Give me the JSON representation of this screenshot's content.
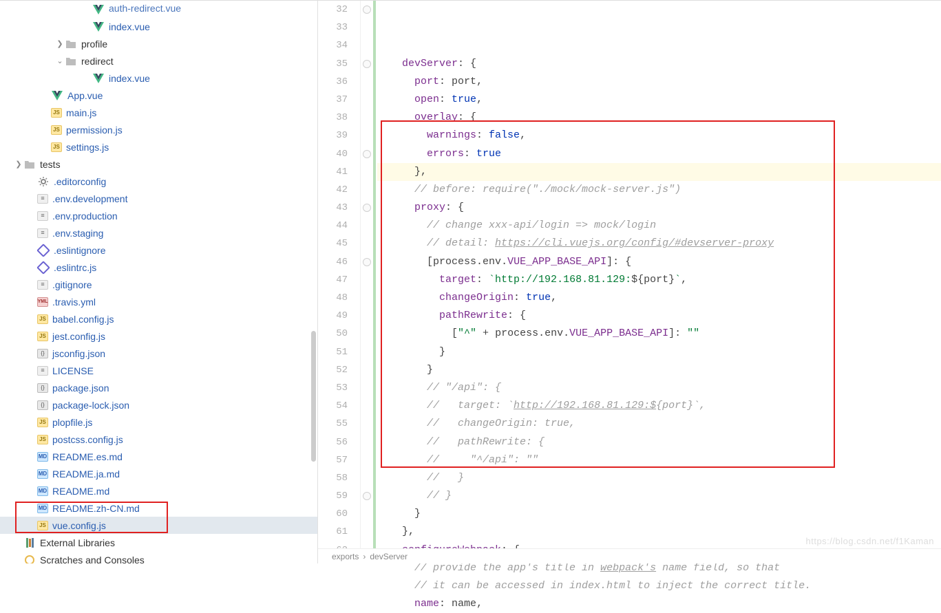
{
  "tree": {
    "items": [
      {
        "depth": 5,
        "chev": "",
        "iconType": "vue",
        "label": "auth-redirect.vue",
        "dark": false,
        "cut": true
      },
      {
        "depth": 5,
        "chev": "",
        "iconType": "vue",
        "label": "index.vue",
        "dark": false
      },
      {
        "depth": 3,
        "chev": ">",
        "iconType": "folder",
        "label": "profile",
        "dark": true
      },
      {
        "depth": 3,
        "chev": "v",
        "iconType": "folder",
        "label": "redirect",
        "dark": true
      },
      {
        "depth": 5,
        "chev": "",
        "iconType": "vue",
        "label": "index.vue",
        "dark": false
      },
      {
        "depth": 2,
        "chev": "",
        "iconType": "vue",
        "label": "App.vue",
        "dark": false
      },
      {
        "depth": 2,
        "chev": "",
        "iconType": "js",
        "label": "main.js",
        "dark": false
      },
      {
        "depth": 2,
        "chev": "",
        "iconType": "js",
        "label": "permission.js",
        "dark": false
      },
      {
        "depth": 2,
        "chev": "",
        "iconType": "js",
        "label": "settings.js",
        "dark": false
      },
      {
        "depth": 0,
        "chev": ">",
        "iconType": "folder",
        "label": "tests",
        "dark": true
      },
      {
        "depth": 1,
        "chev": "",
        "iconType": "gear",
        "label": ".editorconfig",
        "dark": false
      },
      {
        "depth": 1,
        "chev": "",
        "iconType": "txt",
        "label": ".env.development",
        "dark": false
      },
      {
        "depth": 1,
        "chev": "",
        "iconType": "txt",
        "label": ".env.production",
        "dark": false
      },
      {
        "depth": 1,
        "chev": "",
        "iconType": "txt",
        "label": ".env.staging",
        "dark": false
      },
      {
        "depth": 1,
        "chev": "",
        "iconType": "eslint",
        "label": ".eslintignore",
        "dark": false
      },
      {
        "depth": 1,
        "chev": "",
        "iconType": "eslint",
        "label": ".eslintrc.js",
        "dark": false
      },
      {
        "depth": 1,
        "chev": "",
        "iconType": "txt",
        "label": ".gitignore",
        "dark": false
      },
      {
        "depth": 1,
        "chev": "",
        "iconType": "yml",
        "label": ".travis.yml",
        "dark": false
      },
      {
        "depth": 1,
        "chev": "",
        "iconType": "js",
        "label": "babel.config.js",
        "dark": false
      },
      {
        "depth": 1,
        "chev": "",
        "iconType": "js",
        "label": "jest.config.js",
        "dark": false
      },
      {
        "depth": 1,
        "chev": "",
        "iconType": "json",
        "label": "jsconfig.json",
        "dark": false
      },
      {
        "depth": 1,
        "chev": "",
        "iconType": "txt",
        "label": "LICENSE",
        "dark": false
      },
      {
        "depth": 1,
        "chev": "",
        "iconType": "json",
        "label": "package.json",
        "dark": false
      },
      {
        "depth": 1,
        "chev": "",
        "iconType": "json",
        "label": "package-lock.json",
        "dark": false
      },
      {
        "depth": 1,
        "chev": "",
        "iconType": "js",
        "label": "plopfile.js",
        "dark": false
      },
      {
        "depth": 1,
        "chev": "",
        "iconType": "js",
        "label": "postcss.config.js",
        "dark": false
      },
      {
        "depth": 1,
        "chev": "",
        "iconType": "md",
        "label": "README.es.md",
        "dark": false
      },
      {
        "depth": 1,
        "chev": "",
        "iconType": "md",
        "label": "README.ja.md",
        "dark": false
      },
      {
        "depth": 1,
        "chev": "",
        "iconType": "md",
        "label": "README.md",
        "dark": false
      },
      {
        "depth": 1,
        "chev": "",
        "iconType": "md",
        "label": "README.zh-CN.md",
        "dark": false
      },
      {
        "depth": 1,
        "chev": "",
        "iconType": "js",
        "label": "vue.config.js",
        "dark": false,
        "selected": true
      },
      {
        "depth": 0,
        "chev": "",
        "iconType": "lib",
        "label": "External Libraries",
        "dark": true
      },
      {
        "depth": 0,
        "chev": "",
        "iconType": "scratch",
        "label": "Scratches and Consoles",
        "dark": true
      }
    ]
  },
  "editor": {
    "startLine": 32,
    "highlightLine": 38,
    "lines": [
      {
        "n": 32,
        "seg": [
          {
            "t": "    ",
            "c": ""
          },
          {
            "t": "devServer",
            "c": "prop"
          },
          {
            "t": ": {",
            "c": "ident"
          }
        ]
      },
      {
        "n": 33,
        "seg": [
          {
            "t": "      ",
            "c": ""
          },
          {
            "t": "port",
            "c": "prop"
          },
          {
            "t": ": ",
            "c": "ident"
          },
          {
            "t": "port",
            "c": "ident"
          },
          {
            "t": ",",
            "c": "ident"
          }
        ]
      },
      {
        "n": 34,
        "seg": [
          {
            "t": "      ",
            "c": ""
          },
          {
            "t": "open",
            "c": "prop"
          },
          {
            "t": ": ",
            "c": "ident"
          },
          {
            "t": "true",
            "c": "bool"
          },
          {
            "t": ",",
            "c": "ident"
          }
        ]
      },
      {
        "n": 35,
        "seg": [
          {
            "t": "      ",
            "c": ""
          },
          {
            "t": "overlay",
            "c": "prop"
          },
          {
            "t": ": {",
            "c": "ident"
          }
        ]
      },
      {
        "n": 36,
        "seg": [
          {
            "t": "        ",
            "c": ""
          },
          {
            "t": "warnings",
            "c": "prop"
          },
          {
            "t": ": ",
            "c": "ident"
          },
          {
            "t": "false",
            "c": "bool"
          },
          {
            "t": ",",
            "c": "ident"
          }
        ]
      },
      {
        "n": 37,
        "seg": [
          {
            "t": "        ",
            "c": ""
          },
          {
            "t": "errors",
            "c": "prop"
          },
          {
            "t": ": ",
            "c": "ident"
          },
          {
            "t": "true",
            "c": "bool"
          }
        ]
      },
      {
        "n": 38,
        "seg": [
          {
            "t": "      },",
            "c": "ident"
          }
        ]
      },
      {
        "n": 39,
        "seg": [
          {
            "t": "      ",
            "c": ""
          },
          {
            "t": "// before: require(\"./mock/mock-server.js\")",
            "c": "cmt"
          }
        ]
      },
      {
        "n": 40,
        "seg": [
          {
            "t": "      ",
            "c": ""
          },
          {
            "t": "proxy",
            "c": "prop"
          },
          {
            "t": ": {",
            "c": "ident"
          }
        ]
      },
      {
        "n": 41,
        "seg": [
          {
            "t": "        ",
            "c": ""
          },
          {
            "t": "// change xxx-api/login => mock/login",
            "c": "cmt"
          }
        ]
      },
      {
        "n": 42,
        "seg": [
          {
            "t": "        ",
            "c": ""
          },
          {
            "t": "// detail: ",
            "c": "cmt"
          },
          {
            "t": "https://cli.vuejs.org/config/#devserver-proxy",
            "c": "cmt url"
          }
        ]
      },
      {
        "n": 43,
        "seg": [
          {
            "t": "        [",
            "c": "ident"
          },
          {
            "t": "process",
            "c": "ident"
          },
          {
            "t": ".",
            "c": "ident"
          },
          {
            "t": "env",
            "c": "ident"
          },
          {
            "t": ".",
            "c": "ident"
          },
          {
            "t": "VUE_APP_BASE_API",
            "c": "prop"
          },
          {
            "t": "]: {",
            "c": "ident"
          }
        ]
      },
      {
        "n": 44,
        "seg": [
          {
            "t": "          ",
            "c": ""
          },
          {
            "t": "target",
            "c": "prop"
          },
          {
            "t": ": ",
            "c": "ident"
          },
          {
            "t": "`http://192.168.81.129:",
            "c": "str"
          },
          {
            "t": "${",
            "c": "ident"
          },
          {
            "t": "port",
            "c": "ident"
          },
          {
            "t": "}",
            "c": "ident"
          },
          {
            "t": "`",
            "c": "str"
          },
          {
            "t": ",",
            "c": "ident"
          }
        ]
      },
      {
        "n": 45,
        "seg": [
          {
            "t": "          ",
            "c": ""
          },
          {
            "t": "changeOrigin",
            "c": "prop"
          },
          {
            "t": ": ",
            "c": "ident"
          },
          {
            "t": "true",
            "c": "bool"
          },
          {
            "t": ",",
            "c": "ident"
          }
        ]
      },
      {
        "n": 46,
        "seg": [
          {
            "t": "          ",
            "c": ""
          },
          {
            "t": "pathRewrite",
            "c": "prop"
          },
          {
            "t": ": {",
            "c": "ident"
          }
        ]
      },
      {
        "n": 47,
        "seg": [
          {
            "t": "            [",
            "c": "ident"
          },
          {
            "t": "\"^\"",
            "c": "str"
          },
          {
            "t": " + ",
            "c": "ident"
          },
          {
            "t": "process",
            "c": "ident"
          },
          {
            "t": ".",
            "c": "ident"
          },
          {
            "t": "env",
            "c": "ident"
          },
          {
            "t": ".",
            "c": "ident"
          },
          {
            "t": "VUE_APP_BASE_API",
            "c": "prop"
          },
          {
            "t": "]: ",
            "c": "ident"
          },
          {
            "t": "\"\"",
            "c": "str"
          }
        ]
      },
      {
        "n": 48,
        "seg": [
          {
            "t": "          }",
            "c": "ident"
          }
        ]
      },
      {
        "n": 49,
        "seg": [
          {
            "t": "        }",
            "c": "ident"
          }
        ]
      },
      {
        "n": 50,
        "seg": [
          {
            "t": "        ",
            "c": ""
          },
          {
            "t": "// \"/api\": {",
            "c": "cmt"
          }
        ]
      },
      {
        "n": 51,
        "seg": [
          {
            "t": "        ",
            "c": ""
          },
          {
            "t": "//   target: `",
            "c": "cmt"
          },
          {
            "t": "http://192.168.81.129:$",
            "c": "cmt url"
          },
          {
            "t": "{port}`,",
            "c": "cmt"
          }
        ]
      },
      {
        "n": 52,
        "seg": [
          {
            "t": "        ",
            "c": ""
          },
          {
            "t": "//   changeOrigin: true,",
            "c": "cmt"
          }
        ]
      },
      {
        "n": 53,
        "seg": [
          {
            "t": "        ",
            "c": ""
          },
          {
            "t": "//   pathRewrite: {",
            "c": "cmt"
          }
        ]
      },
      {
        "n": 54,
        "seg": [
          {
            "t": "        ",
            "c": ""
          },
          {
            "t": "//     \"^/api\": \"\"",
            "c": "cmt"
          }
        ]
      },
      {
        "n": 55,
        "seg": [
          {
            "t": "        ",
            "c": ""
          },
          {
            "t": "//   }",
            "c": "cmt"
          }
        ]
      },
      {
        "n": 56,
        "seg": [
          {
            "t": "        ",
            "c": ""
          },
          {
            "t": "// }",
            "c": "cmt"
          }
        ]
      },
      {
        "n": 57,
        "seg": [
          {
            "t": "      }",
            "c": "ident"
          }
        ]
      },
      {
        "n": 58,
        "seg": [
          {
            "t": "    },",
            "c": "ident"
          }
        ]
      },
      {
        "n": 59,
        "seg": [
          {
            "t": "    ",
            "c": ""
          },
          {
            "t": "configureWebpack",
            "c": "prop"
          },
          {
            "t": ": {",
            "c": "ident"
          }
        ]
      },
      {
        "n": 60,
        "seg": [
          {
            "t": "      ",
            "c": ""
          },
          {
            "t": "// provide the app's title in ",
            "c": "cmt"
          },
          {
            "t": "webpack's",
            "c": "cmt url"
          },
          {
            "t": " name field, so that",
            "c": "cmt"
          }
        ]
      },
      {
        "n": 61,
        "seg": [
          {
            "t": "      ",
            "c": ""
          },
          {
            "t": "// it can be accessed in index.html to inject the correct title.",
            "c": "cmt"
          }
        ]
      },
      {
        "n": 62,
        "seg": [
          {
            "t": "      ",
            "c": ""
          },
          {
            "t": "name",
            "c": "prop"
          },
          {
            "t": ": ",
            "c": "ident"
          },
          {
            "t": "name",
            "c": "ident"
          },
          {
            "t": ",",
            "c": "ident"
          }
        ]
      }
    ],
    "breadcrumb": [
      "exports",
      "devServer"
    ],
    "watermark": "https://blog.csdn.net/f1Kaman"
  }
}
